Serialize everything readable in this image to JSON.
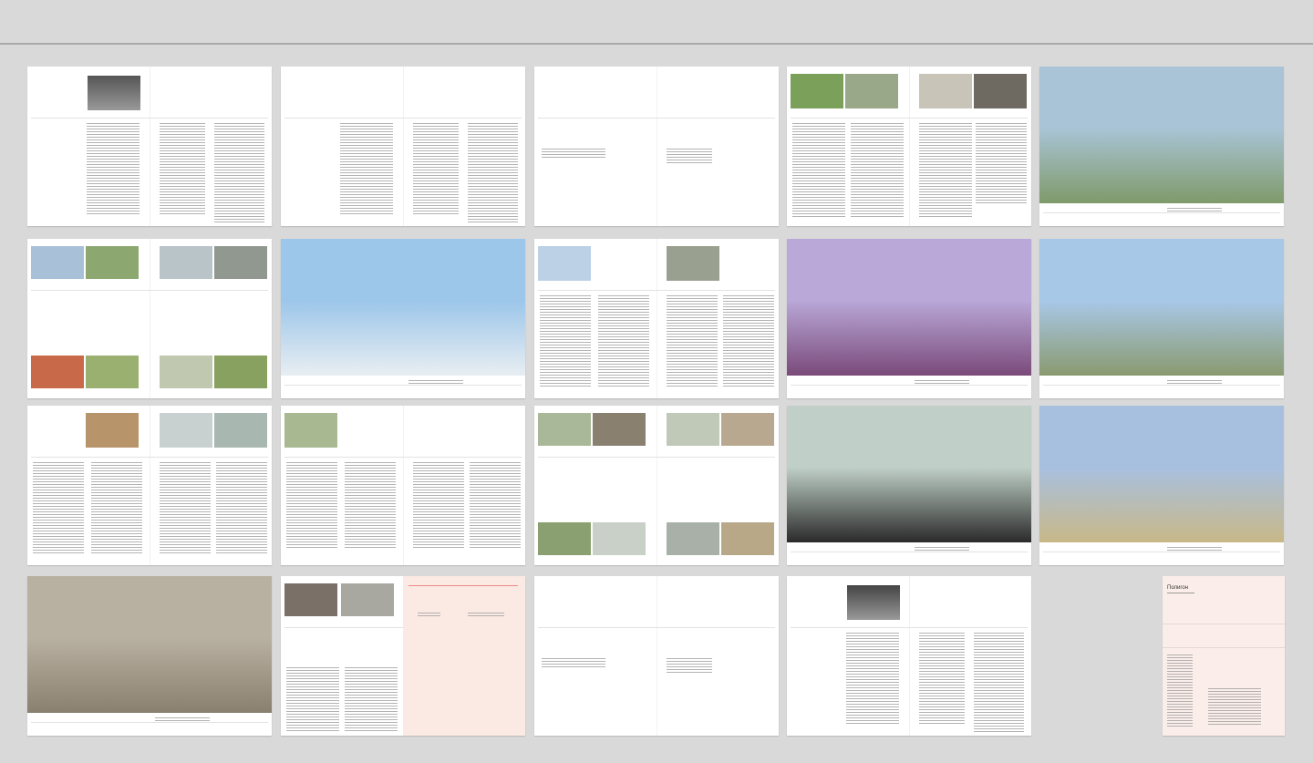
{
  "view": "spreads-overview",
  "cover": {
    "title": "Полигон"
  },
  "spreads": [
    {
      "kind": "text",
      "photos": [
        "#555"
      ]
    },
    {
      "kind": "text",
      "photos": []
    },
    {
      "kind": "sparse",
      "photos": []
    },
    {
      "kind": "top4",
      "photos": [
        "#7aa05a",
        "#9aa88a",
        "#c8c4b8",
        "#6e6a62"
      ]
    },
    {
      "kind": "full",
      "photos": [
        "#a9c4d6",
        "#7f9a6a"
      ]
    },
    {
      "kind": "grid",
      "photos": [
        "#a8c0d8",
        "#8ca870",
        "#b8c4c8",
        "#909890",
        "#c86a4a",
        "#9ab070",
        "#c0c8b0",
        "#88a060"
      ]
    },
    {
      "kind": "full",
      "photos": [
        "#9cc6ea",
        "#e8eef2"
      ]
    },
    {
      "kind": "top2",
      "photos": [
        "#bcd0e6",
        "#9aa090"
      ]
    },
    {
      "kind": "full",
      "photos": [
        "#b9a8d8",
        "#7a4a7a"
      ]
    },
    {
      "kind": "full",
      "photos": [
        "#a8c8e8",
        "#8a9a70"
      ]
    },
    {
      "kind": "top3",
      "photos": [
        "#b8946a",
        "#c8d0d0",
        "#a8b8b0"
      ]
    },
    {
      "kind": "top1",
      "photos": [
        "#a8b890"
      ]
    },
    {
      "kind": "grid",
      "photos": [
        "#a8b898",
        "#8a8070",
        "#c0c8b8",
        "#b8a890",
        "#8aa070",
        "#c8d0c8",
        "#a8b0a8",
        "#b8a888"
      ]
    },
    {
      "kind": "full",
      "photos": [
        "#c0d0c8",
        "#2a2a2a"
      ]
    },
    {
      "kind": "full",
      "photos": [
        "#a8c0e0",
        "#c8b888"
      ]
    },
    {
      "kind": "full",
      "photos": [
        "#b8b0a0",
        "#8a8070"
      ]
    },
    {
      "kind": "diagram",
      "photos": [
        "#7a7068",
        "#a8a8a0"
      ]
    },
    {
      "kind": "sparse",
      "photos": []
    },
    {
      "kind": "text",
      "photos": [
        "#444"
      ]
    }
  ]
}
